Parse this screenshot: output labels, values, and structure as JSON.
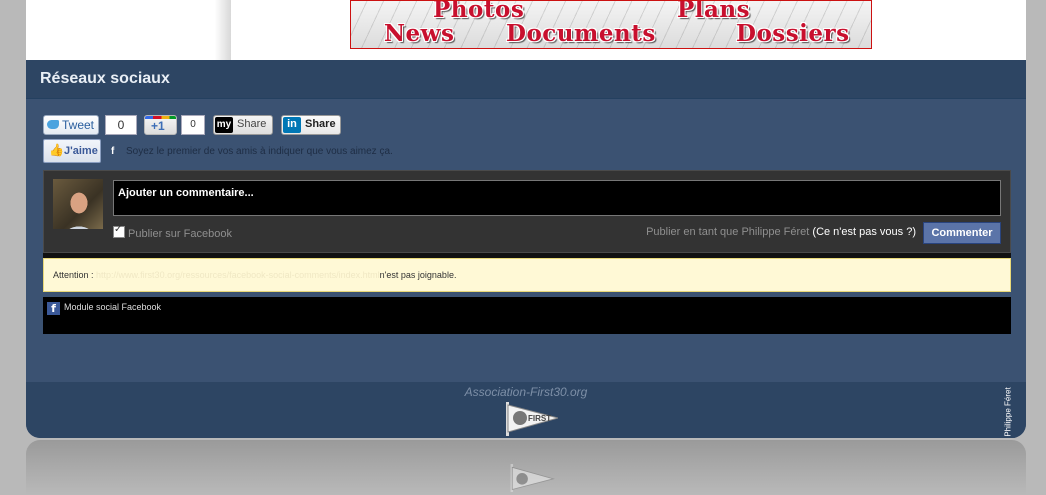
{
  "banner": {
    "words": [
      "Photos",
      "Plans",
      "News",
      "Documents",
      "Dossiers"
    ]
  },
  "section": {
    "title": "Réseaux sociaux"
  },
  "share": {
    "tweet_label": "Tweet",
    "tweet_count": "0",
    "gplus_label": "+1",
    "gplus_count": "0",
    "myspace_logo": "my",
    "myspace_label": "Share",
    "linkedin_logo": "in",
    "linkedin_label": "Share",
    "like_label": "J'aime",
    "like_text": "Soyez le premier de vos amis à indiquer que vous aimez ça."
  },
  "comments": {
    "placeholder": "Ajouter un commentaire...",
    "publish_facebook": "Publier sur Facebook",
    "publish_as": "Publier en tant que Philippe Féret",
    "not_you": "(Ce n'est pas vous ?)",
    "submit_label": "Commenter"
  },
  "warning": {
    "prefix": "Attention :",
    "url": "http://www.first30.org/ressources/facebook-social-comments/index.html",
    "suffix": "n'est pas joignable."
  },
  "module": {
    "icon": "f",
    "label": "Module social Facebook"
  },
  "footer": {
    "site": "Association-First30.org",
    "author": "Philippe Féret",
    "logo_text": "FIRST"
  },
  "colors": {
    "panel": "#3b5272",
    "header": "#2d4563",
    "accent_red": "#c8102e",
    "comment_button": "#5b74a8"
  }
}
